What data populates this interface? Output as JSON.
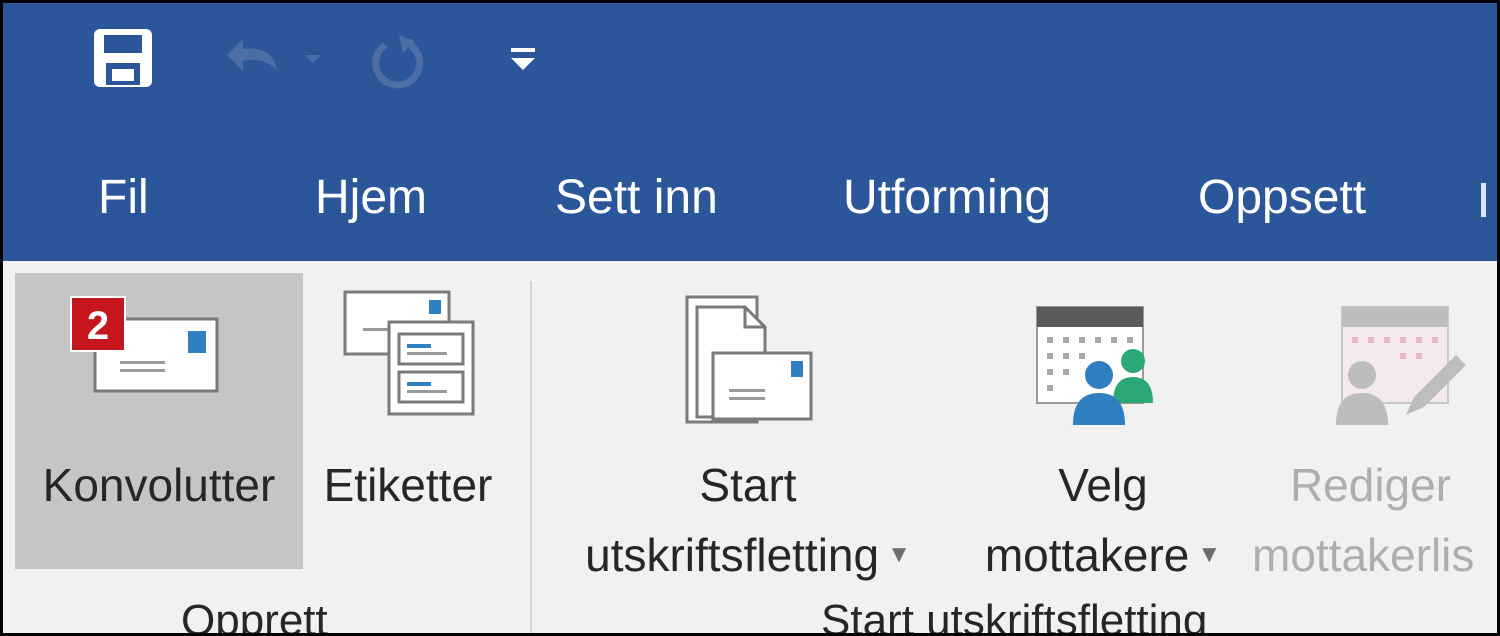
{
  "quick_access": {
    "save_icon": "save-icon",
    "undo_icon": "undo-icon",
    "redo_icon": "redo-icon",
    "customize_icon": "customize-quick-access-icon"
  },
  "tabs": [
    {
      "label": "Fil"
    },
    {
      "label": "Hjem"
    },
    {
      "label": "Sett inn"
    },
    {
      "label": "Utforming"
    },
    {
      "label": "Oppsett"
    }
  ],
  "ribbon": {
    "groups": [
      {
        "label": "Opprett",
        "buttons": [
          {
            "label": "Konvolutter",
            "badge": "2",
            "icon": "envelope-icon"
          },
          {
            "label": "Etiketter",
            "icon": "labels-icon"
          }
        ]
      },
      {
        "label": "Start utskriftsfletting",
        "buttons": [
          {
            "line1": "Start",
            "line2": "utskriftsfletting",
            "icon": "start-mail-merge-icon"
          },
          {
            "line1": "Velg",
            "line2": "mottakere",
            "icon": "select-recipients-icon"
          },
          {
            "line1": "Rediger",
            "line2": "mottakerlis",
            "icon": "edit-recipient-list-icon",
            "disabled": true
          }
        ]
      }
    ]
  },
  "colors": {
    "title_bar": "#2b579a",
    "ribbon": "#f1f1f1",
    "selected_button": "#c5c5c5",
    "badge": "#c4161c",
    "disabled_text": "#aeaeae"
  }
}
